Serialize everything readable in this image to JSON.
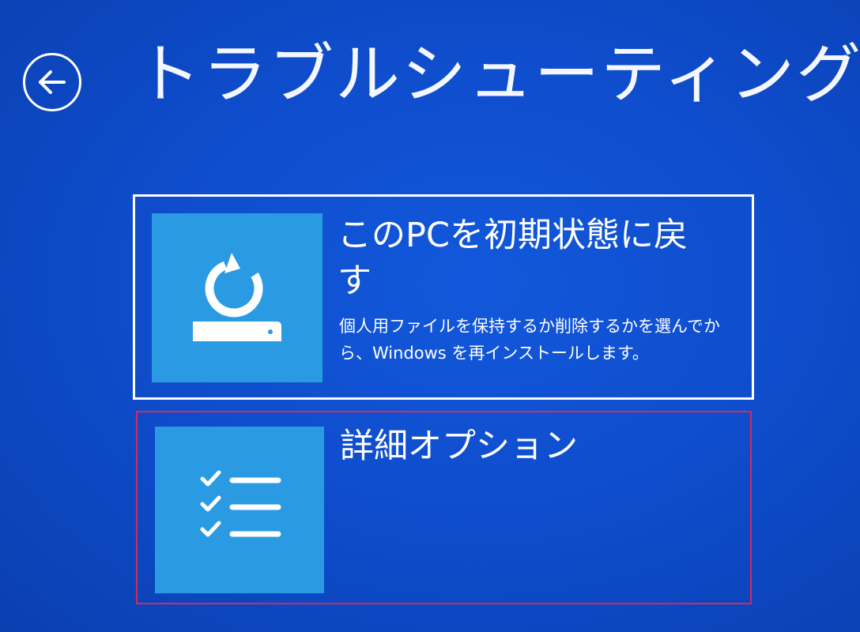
{
  "screen": {
    "title": "トラブルシューティング",
    "background_color": "#0e4bc9"
  },
  "back": {
    "icon": "back-arrow-circle-icon"
  },
  "options": [
    {
      "title": "このPCを初期状態に戻す",
      "description": "個人用ファイルを保持するか削除するかを選んでから、Windows を再インストールします。",
      "icon": "reset-pc-icon",
      "border_color": "#ffffff"
    },
    {
      "title": "詳細オプション",
      "description": "",
      "icon": "checklist-icon",
      "border_color": "#d42a5a"
    }
  ],
  "colors": {
    "tile_icon_background": "#2a9ae2",
    "text": "#ffffff"
  }
}
